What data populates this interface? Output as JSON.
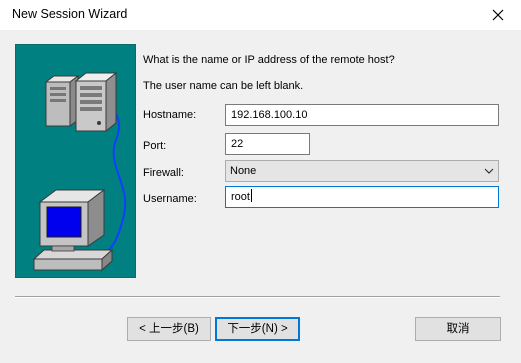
{
  "window": {
    "title": "New Session Wizard",
    "close_icon": "close-icon"
  },
  "intro": {
    "question": "What is the name or IP address of the remote host?",
    "note": "The user name can be left blank."
  },
  "form": {
    "hostname": {
      "label": "Hostname:",
      "value": "192.168.100.10"
    },
    "port": {
      "label": "Port:",
      "value": "22"
    },
    "firewall": {
      "label": "Firewall:",
      "value": "None"
    },
    "username": {
      "label": "Username:",
      "value": "root"
    }
  },
  "buttons": {
    "back": "< 上一步(B)",
    "next": "下一步(N) >",
    "cancel": "取消"
  },
  "colors": {
    "panel": "#008080",
    "accent": "#0078d7",
    "cable": "#1040ff"
  }
}
